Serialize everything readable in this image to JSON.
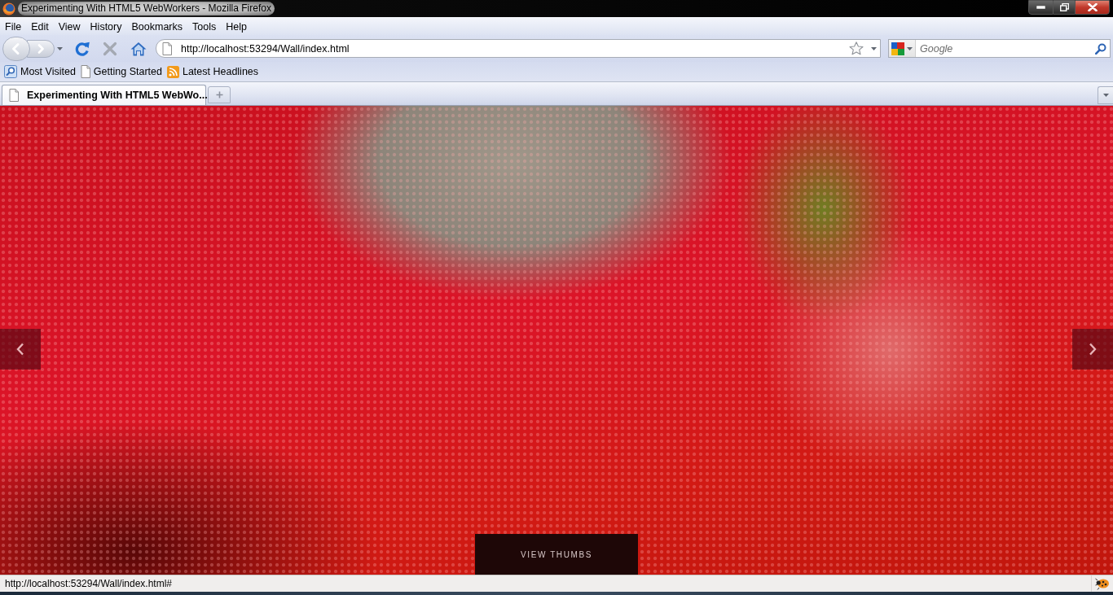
{
  "window": {
    "title": "Experimenting With HTML5 WebWorkers - Mozilla Firefox"
  },
  "menu": [
    "File",
    "Edit",
    "View",
    "History",
    "Bookmarks",
    "Tools",
    "Help"
  ],
  "navigation": {
    "url": "http://localhost:53294/Wall/index.html",
    "search": {
      "placeholder": "Google"
    }
  },
  "bookmarks": [
    {
      "label": "Most Visited",
      "kind": "smart"
    },
    {
      "label": "Getting Started",
      "kind": "page"
    },
    {
      "label": "Latest Headlines",
      "kind": "feed"
    }
  ],
  "tabs": [
    {
      "label": "Experimenting With HTML5 WebWo...",
      "selected": true
    }
  ],
  "page": {
    "view_thumbs_button": "VIEW THUMBS"
  },
  "status_bar": {
    "text": "http://localhost:53294/Wall/index.html#"
  }
}
